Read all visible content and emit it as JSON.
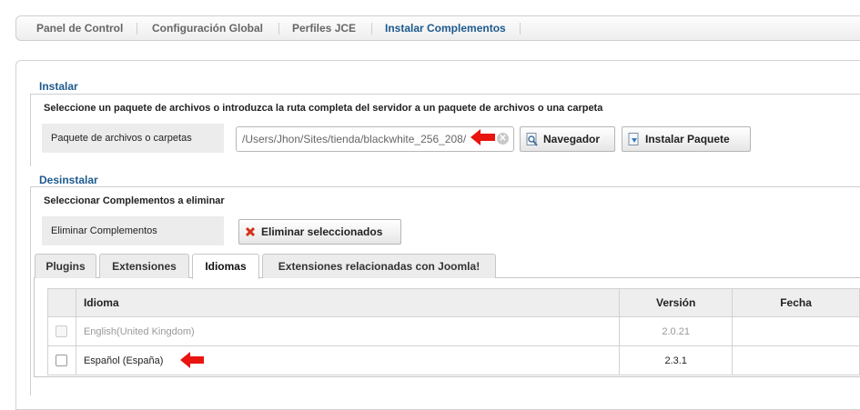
{
  "topnav": {
    "items": [
      {
        "label": "Panel de Control"
      },
      {
        "label": "Configuración Global"
      },
      {
        "label": "Perfiles JCE"
      },
      {
        "label": "Instalar Complementos"
      }
    ]
  },
  "install": {
    "legend": "Instalar",
    "description": "Seleccione un paquete de archivos o introduzca la ruta completa del servidor a un paquete de archivos o una carpeta",
    "field_label": "Paquete de archivos o carpetas",
    "path_value": "/Users/Jhon/Sites/tienda/blackwhite_256_208/",
    "browse_label": "Navegador",
    "install_label": "Instalar Paquete"
  },
  "uninstall": {
    "legend": "Desinstalar",
    "description": "Seleccionar Complementos a eliminar",
    "field_label": "Eliminar Complementos",
    "delete_label": "Eliminar seleccionados"
  },
  "tabs": [
    {
      "label": "Plugins"
    },
    {
      "label": "Extensiones"
    },
    {
      "label": "Idiomas"
    },
    {
      "label": "Extensiones relacionadas con Joomla!"
    }
  ],
  "table": {
    "headers": {
      "name": "Idioma",
      "version": "Versión",
      "date": "Fecha"
    },
    "rows": [
      {
        "name": "English(United Kingdom)",
        "version": "2.0.21",
        "date": ""
      },
      {
        "name": "Español (España)",
        "version": "2.3.1",
        "date": ""
      }
    ]
  },
  "colors": {
    "accent": "#1d5a8e",
    "annotation_arrow": "#e8140f"
  }
}
